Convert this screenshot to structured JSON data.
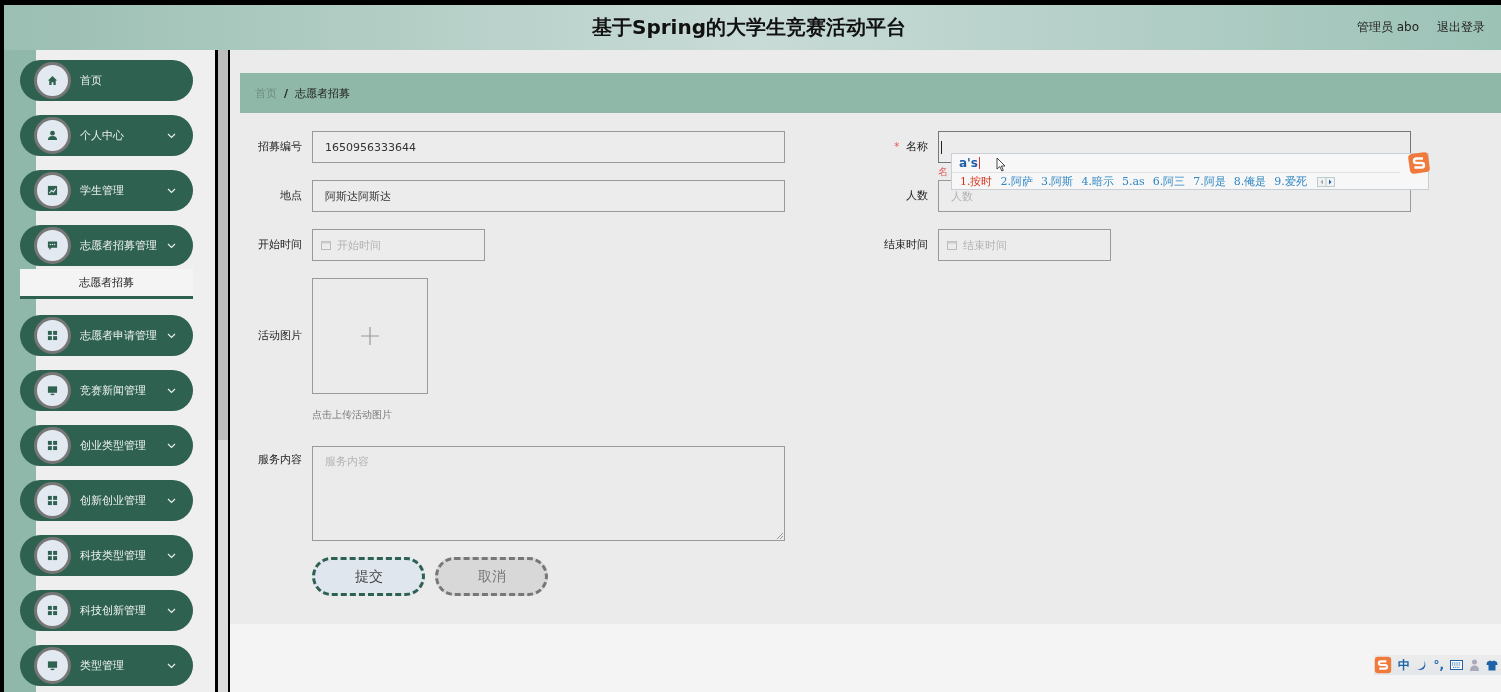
{
  "header": {
    "title": "基于Spring的大学生竞赛活动平台",
    "user": "管理员 abo",
    "logout": "退出登录"
  },
  "sidebar": {
    "items": [
      {
        "label": "首页",
        "kind": "home",
        "submenu": false
      },
      {
        "label": "个人中心",
        "kind": "user",
        "submenu": true,
        "expanded": false
      },
      {
        "label": "学生管理",
        "kind": "chart",
        "submenu": true,
        "expanded": false
      },
      {
        "label": "志愿者招募管理",
        "kind": "message",
        "submenu": true,
        "expanded": true,
        "children": [
          {
            "label": "志愿者招募",
            "selected": true
          }
        ]
      },
      {
        "label": "志愿者申请管理",
        "kind": "grid",
        "submenu": true,
        "expanded": false
      },
      {
        "label": "竞赛新闻管理",
        "kind": "monitor",
        "submenu": true,
        "expanded": false
      },
      {
        "label": "创业类型管理",
        "kind": "grid",
        "submenu": true,
        "expanded": false
      },
      {
        "label": "创新创业管理",
        "kind": "grid",
        "submenu": true,
        "expanded": false
      },
      {
        "label": "科技类型管理",
        "kind": "grid",
        "submenu": true,
        "expanded": false
      },
      {
        "label": "科技创新管理",
        "kind": "grid",
        "submenu": true,
        "expanded": false
      },
      {
        "label": "类型管理",
        "kind": "monitor",
        "submenu": true,
        "expanded": false
      }
    ]
  },
  "breadcrumb": {
    "separator": "/",
    "items": [
      {
        "label": "首页",
        "current": false
      },
      {
        "label": "志愿者招募",
        "current": true
      }
    ]
  },
  "form": {
    "rows": [
      [
        {
          "label": "招募编号",
          "kind": "text",
          "value": "1650956333644"
        },
        {
          "label": "名称",
          "kind": "text",
          "required_mark": "*",
          "focused": true,
          "error": "名"
        }
      ],
      [
        {
          "label": "地点",
          "kind": "text",
          "value": "阿斯达阿斯达"
        },
        {
          "label": "人数",
          "kind": "text",
          "placeholder": "人数"
        }
      ],
      [
        {
          "label": "开始时间",
          "kind": "date",
          "placeholder": "开始时间"
        },
        {
          "label": "结束时间",
          "kind": "date",
          "placeholder": "结束时间"
        }
      ]
    ],
    "upload": {
      "label": "活动图片",
      "hint": "点击上传活动图片"
    },
    "textarea": {
      "label": "服务内容",
      "placeholder": "服务内容"
    },
    "buttons": [
      {
        "label": "提交",
        "kind": "primary"
      },
      {
        "label": "取消",
        "kind": "secondary"
      }
    ]
  },
  "ime_popup": {
    "composition": "a's",
    "candidates": [
      {
        "label": "1.按时",
        "selected": true
      },
      {
        "label": "2.阿萨",
        "selected": false
      },
      {
        "label": "3.阿斯",
        "selected": false
      },
      {
        "label": "4.暗示",
        "selected": false
      },
      {
        "label": "5.as",
        "selected": false
      },
      {
        "label": "6.阿三",
        "selected": false
      },
      {
        "label": "7.阿是",
        "selected": false
      },
      {
        "label": "8.俺是",
        "selected": false
      },
      {
        "label": "9.爱死",
        "selected": false
      }
    ]
  },
  "ime_status": {
    "items": [
      {
        "kind": "logo"
      },
      {
        "kind": "text",
        "label": "中"
      },
      {
        "kind": "moon"
      },
      {
        "kind": "text",
        "label": "°,"
      },
      {
        "kind": "keyboard"
      },
      {
        "kind": "person"
      },
      {
        "kind": "shirt"
      }
    ]
  }
}
